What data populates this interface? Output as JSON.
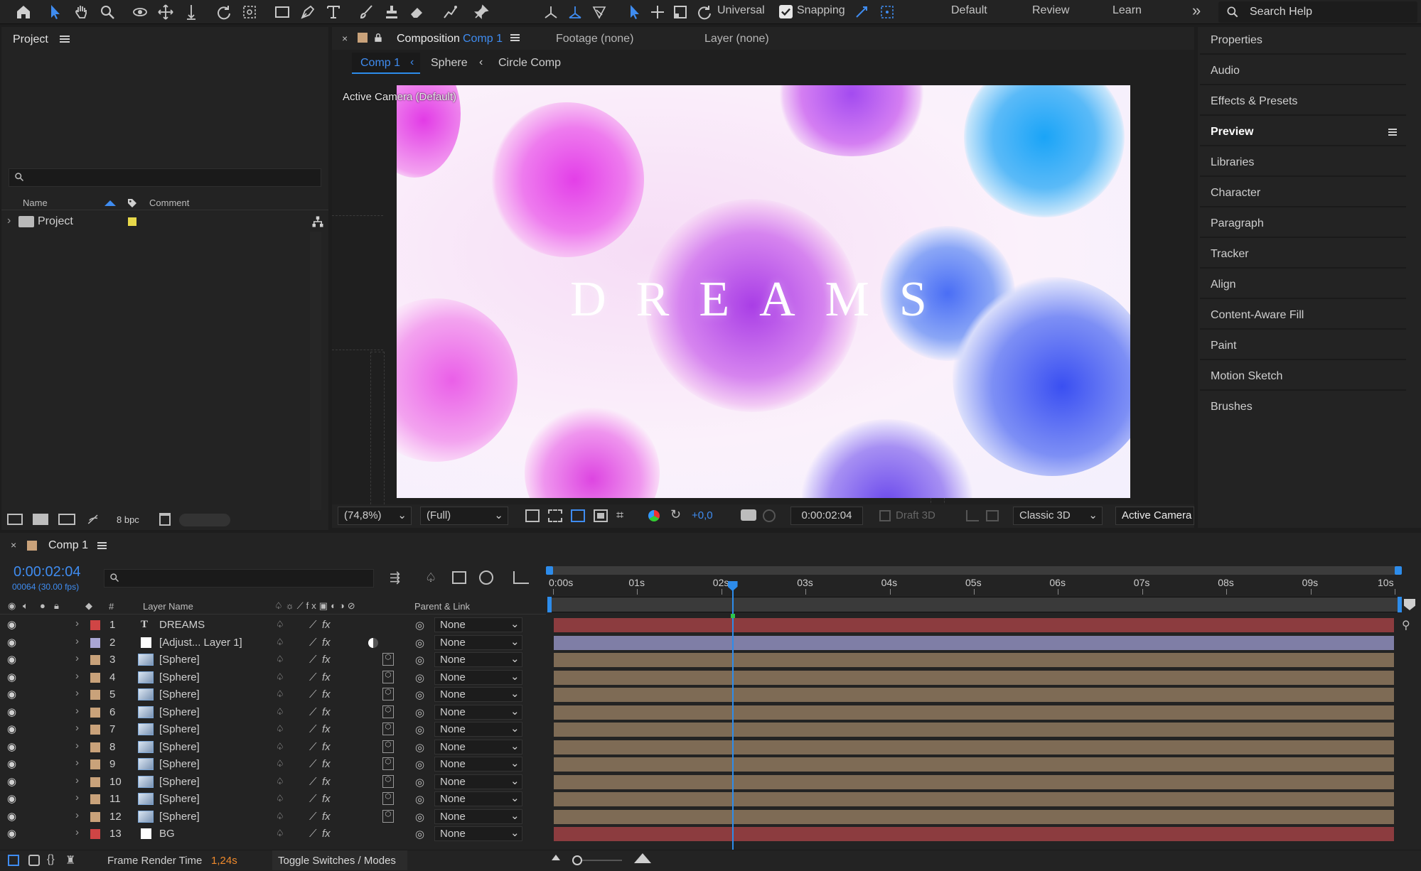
{
  "toolbar": {
    "axis_mode": "Universal",
    "snapping_label": "Snapping",
    "workspaces": [
      "Default",
      "Review",
      "Learn"
    ],
    "more": "»",
    "search_help": "Search Help"
  },
  "project": {
    "title": "Project",
    "col_name": "Name",
    "col_comment": "Comment",
    "item": "Project",
    "bpc": "8 bpc"
  },
  "comp_panel": {
    "tab_prefix": "Composition",
    "tab_comp": "Comp 1",
    "footage_tab": "Footage (none)",
    "layer_tab": "Layer (none)",
    "breadcrumbs": [
      "Comp 1",
      "Sphere",
      "Circle Comp"
    ],
    "camera_label": "Active Camera (Default)",
    "title_text": "DREAMS",
    "zoom": "(74,8%)",
    "resolution": "(Full)",
    "exposure": "+0,0",
    "timecode": "0:00:02:04",
    "draft3d": "Draft 3D",
    "renderer": "Classic 3D",
    "view": "Active Camera"
  },
  "right_panel": {
    "items": [
      "Properties",
      "Audio",
      "Effects & Presets",
      "Preview",
      "Libraries",
      "Character",
      "Paragraph",
      "Tracker",
      "Align",
      "Content-Aware Fill",
      "Paint",
      "Motion Sketch",
      "Brushes"
    ]
  },
  "timeline": {
    "tab": "Comp 1",
    "timecode": "0:00:02:04",
    "frames": "00064 (30.00 fps)",
    "col_num": "#",
    "col_layer": "Layer Name",
    "col_parent": "Parent & Link",
    "ticks": [
      "0:00s",
      "01s",
      "02s",
      "03s",
      "04s",
      "05s",
      "06s",
      "07s",
      "08s",
      "09s",
      "10s"
    ],
    "playhead_fraction": 0.2133,
    "layers": [
      {
        "num": "1",
        "name": "DREAMS",
        "type": "text",
        "label": "#d04545",
        "bar": "#8c3c3f",
        "parent": "None"
      },
      {
        "num": "2",
        "name": "[Adjust... Layer 1]",
        "type": "adjust",
        "label": "#a9a6d4",
        "bar": "#7f7ea6",
        "parent": "None"
      },
      {
        "num": "3",
        "name": "[Sphere]",
        "type": "comp",
        "label": "#c9a27a",
        "bar": "#7e6b55",
        "parent": "None"
      },
      {
        "num": "4",
        "name": "[Sphere]",
        "type": "comp",
        "label": "#c9a27a",
        "bar": "#7e6b55",
        "parent": "None"
      },
      {
        "num": "5",
        "name": "[Sphere]",
        "type": "comp",
        "label": "#c9a27a",
        "bar": "#7e6b55",
        "parent": "None"
      },
      {
        "num": "6",
        "name": "[Sphere]",
        "type": "comp",
        "label": "#c9a27a",
        "bar": "#7e6b55",
        "parent": "None"
      },
      {
        "num": "7",
        "name": "[Sphere]",
        "type": "comp",
        "label": "#c9a27a",
        "bar": "#7e6b55",
        "parent": "None"
      },
      {
        "num": "8",
        "name": "[Sphere]",
        "type": "comp",
        "label": "#c9a27a",
        "bar": "#7e6b55",
        "parent": "None"
      },
      {
        "num": "9",
        "name": "[Sphere]",
        "type": "comp",
        "label": "#c9a27a",
        "bar": "#7e6b55",
        "parent": "None"
      },
      {
        "num": "10",
        "name": "[Sphere]",
        "type": "comp",
        "label": "#c9a27a",
        "bar": "#7e6b55",
        "parent": "None"
      },
      {
        "num": "11",
        "name": "[Sphere]",
        "type": "comp",
        "label": "#c9a27a",
        "bar": "#7e6b55",
        "parent": "None"
      },
      {
        "num": "12",
        "name": "[Sphere]",
        "type": "comp",
        "label": "#c9a27a",
        "bar": "#7e6b55",
        "parent": "None"
      },
      {
        "num": "13",
        "name": "BG",
        "type": "solid",
        "label": "#d04545",
        "bar": "#8c3c3f",
        "parent": "None"
      }
    ]
  },
  "status": {
    "frame_render_label": "Frame Render Time",
    "frame_render_value": "1,24s",
    "toggle": "Toggle Switches / Modes"
  },
  "colors": {
    "accent": "#2d8ceb",
    "panel": "#232323",
    "background": "#1d1d1d"
  }
}
